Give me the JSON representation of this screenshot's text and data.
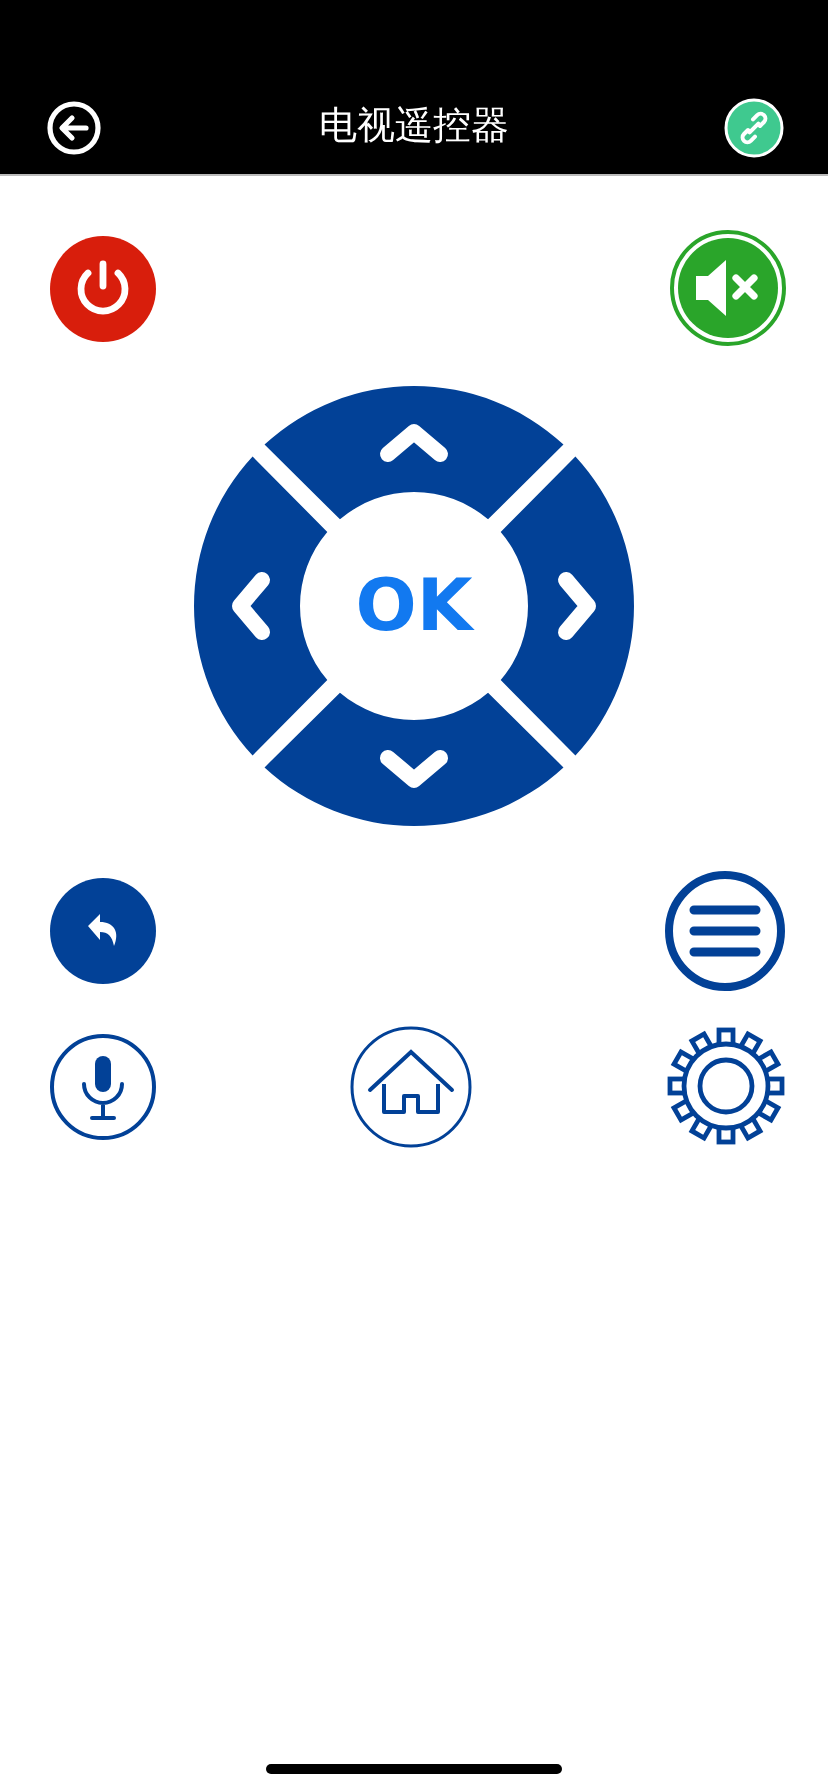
{
  "header": {
    "title": "电视遥控器"
  },
  "dpad": {
    "center_label": "OK"
  }
}
